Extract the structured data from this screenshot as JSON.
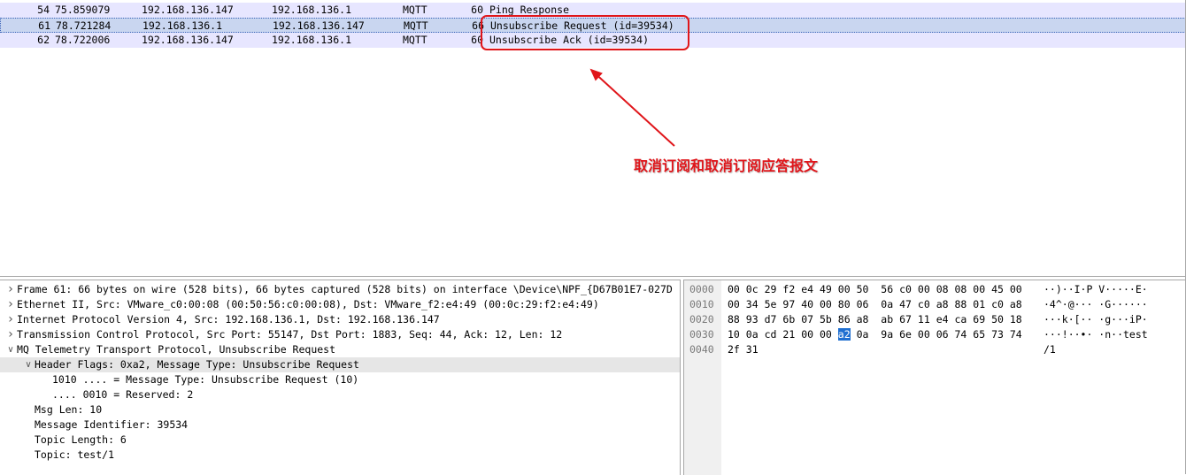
{
  "packets": [
    {
      "no": "54",
      "time": "75.859079",
      "src": "192.168.136.147",
      "dst": "192.168.136.1",
      "proto": "MQTT",
      "len": "60",
      "info": "Ping Response",
      "selected": false
    },
    {
      "no": "61",
      "time": "78.721284",
      "src": "192.168.136.1",
      "dst": "192.168.136.147",
      "proto": "MQTT",
      "len": "66",
      "info": "Unsubscribe Request (id=39534)",
      "selected": true
    },
    {
      "no": "62",
      "time": "78.722006",
      "src": "192.168.136.147",
      "dst": "192.168.136.1",
      "proto": "MQTT",
      "len": "60",
      "info": "Unsubscribe Ack (id=39534)",
      "selected": false
    }
  ],
  "annotation": {
    "label": "取消订阅和取消订阅应答报文",
    "color": "#e0151a"
  },
  "details": [
    {
      "indent": 0,
      "arrow": "collapsed",
      "text": "Frame 61: 66 bytes on wire (528 bits), 66 bytes captured (528 bits) on interface \\Device\\NPF_{D67B01E7-027D",
      "selected": false
    },
    {
      "indent": 0,
      "arrow": "collapsed",
      "text": "Ethernet II, Src: VMware_c0:00:08 (00:50:56:c0:00:08), Dst: VMware_f2:e4:49 (00:0c:29:f2:e4:49)",
      "selected": false
    },
    {
      "indent": 0,
      "arrow": "collapsed",
      "text": "Internet Protocol Version 4, Src: 192.168.136.1, Dst: 192.168.136.147",
      "selected": false
    },
    {
      "indent": 0,
      "arrow": "collapsed",
      "text": "Transmission Control Protocol, Src Port: 55147, Dst Port: 1883, Seq: 44, Ack: 12, Len: 12",
      "selected": false
    },
    {
      "indent": 0,
      "arrow": "expanded",
      "text": "MQ Telemetry Transport Protocol, Unsubscribe Request",
      "selected": false
    },
    {
      "indent": 1,
      "arrow": "expanded",
      "text": "Header Flags: 0xa2, Message Type: Unsubscribe Request",
      "selected": true
    },
    {
      "indent": 2,
      "arrow": "none",
      "text": "1010 .... = Message Type: Unsubscribe Request (10)",
      "selected": false
    },
    {
      "indent": 2,
      "arrow": "none",
      "text": ".... 0010 = Reserved: 2",
      "selected": false
    },
    {
      "indent": 1,
      "arrow": "none",
      "text": "Msg Len: 10",
      "selected": false
    },
    {
      "indent": 1,
      "arrow": "none",
      "text": "Message Identifier: 39534",
      "selected": false
    },
    {
      "indent": 1,
      "arrow": "none",
      "text": "Topic Length: 6",
      "selected": false
    },
    {
      "indent": 1,
      "arrow": "none",
      "text": "Topic: test/1",
      "selected": false
    }
  ],
  "bytes": [
    {
      "offset": "0000",
      "hex": [
        "00",
        "0c",
        "29",
        "f2",
        "e4",
        "49",
        "00",
        "50",
        "56",
        "c0",
        "00",
        "08",
        "08",
        "00",
        "45",
        "00"
      ],
      "ascii": "··)··I·P V·····E·"
    },
    {
      "offset": "0010",
      "hex": [
        "00",
        "34",
        "5e",
        "97",
        "40",
        "00",
        "80",
        "06",
        "0a",
        "47",
        "c0",
        "a8",
        "88",
        "01",
        "c0",
        "a8"
      ],
      "ascii": "·4^·@··· ·G······"
    },
    {
      "offset": "0020",
      "hex": [
        "88",
        "93",
        "d7",
        "6b",
        "07",
        "5b",
        "86",
        "a8",
        "ab",
        "67",
        "11",
        "e4",
        "ca",
        "69",
        "50",
        "18"
      ],
      "ascii": "···k·[·· ·g···iP·"
    },
    {
      "offset": "0030",
      "hex": [
        "10",
        "0a",
        "cd",
        "21",
        "00",
        "00",
        "a2",
        "0a",
        "9a",
        "6e",
        "00",
        "06",
        "74",
        "65",
        "73",
        "74"
      ],
      "ascii": "···!··•· ·n··test",
      "highlight_index": 6
    },
    {
      "offset": "0040",
      "hex": [
        "2f",
        "31"
      ],
      "ascii": "/1"
    }
  ]
}
